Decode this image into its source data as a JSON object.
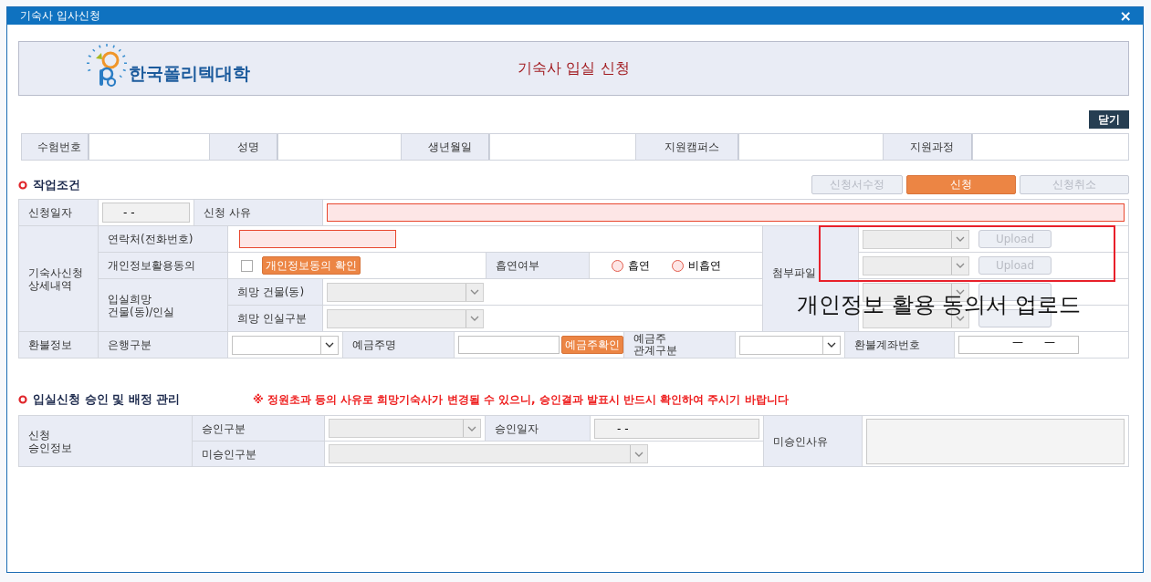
{
  "window": {
    "title": "기숙사 입사신청",
    "close": "×"
  },
  "header": {
    "org_name": "한국폴리텍대학",
    "title": "기숙사 입실 신청"
  },
  "close_button": "닫기",
  "applicant_info": [
    {
      "label": "수험번호"
    },
    {
      "label": "성명"
    },
    {
      "label": "생년월일"
    },
    {
      "label": "지원캠퍼스"
    },
    {
      "label": "지원과정"
    }
  ],
  "work_section": {
    "title": "작업조건",
    "actions": [
      {
        "label": "신청서수정",
        "disabled": true
      },
      {
        "label": "신청",
        "disabled": false
      },
      {
        "label": "신청취소",
        "disabled": true
      }
    ]
  },
  "application": {
    "date": {
      "label": "신청일자",
      "value": "- -"
    },
    "reason": {
      "label": "신청 사유",
      "required": true
    },
    "detail_label": "기숙사신청\n상세내역",
    "contact": {
      "label": "연락처(전화번호)",
      "required": true
    },
    "consent": {
      "label": "개인정보활용동의",
      "checked": false,
      "button": "개인정보동의 확인"
    },
    "smoking": {
      "label": "흡연여부",
      "options": [
        {
          "label": "흡연",
          "selected": false
        },
        {
          "label": "비흡연",
          "selected": false
        }
      ]
    },
    "room_pref": {
      "label": "입실희망\n건물(동)/인실",
      "fields": [
        {
          "label": "희망 건물(동)",
          "disabled": true
        },
        {
          "label": "희망 인실구분",
          "disabled": true
        }
      ]
    },
    "attachments": {
      "label": "첨부파일",
      "rows": [
        {
          "button": "Upload",
          "disabled": true
        },
        {
          "button": "Upload",
          "disabled": true
        },
        {
          "disabled": true
        },
        {
          "disabled": true
        }
      ]
    },
    "refund": {
      "label": "환불정보",
      "bank": {
        "label": "은행구분",
        "disabled": false
      },
      "holder": {
        "label": "예금주명",
        "button": "예금주확인"
      },
      "relation": {
        "label": "예금주\n관계구분",
        "disabled": false
      },
      "account": {
        "label": "환불계좌번호",
        "value": "—      —"
      }
    }
  },
  "annotation": {
    "text": "개인정보 활용 동의서 업로드"
  },
  "approval_section": {
    "title": "입실신청 승인 및 배정 관리",
    "notice": "※ 정원초과 등의 사유로 희망기숙사가 변경될 수 있으니, 승인결과 발표시 반드시 확인하여 주시기 바랍니다",
    "info_label": "신청\n승인정보",
    "type": {
      "label": "승인구분",
      "disabled": true
    },
    "date": {
      "label": "승인일자",
      "value": "- -"
    },
    "reject_type": {
      "label": "미승인구분",
      "disabled": true
    },
    "reject_reason": {
      "label": "미승인사유"
    }
  }
}
